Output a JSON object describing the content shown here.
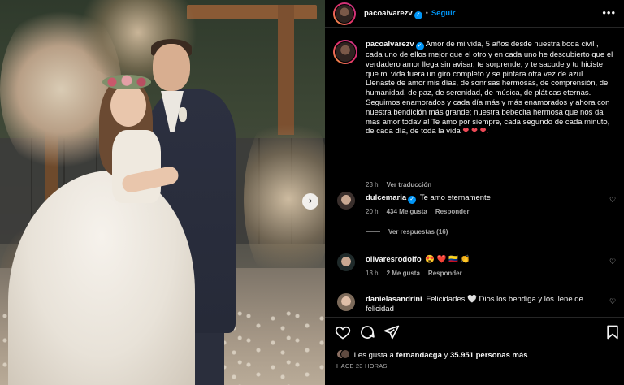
{
  "post": {
    "username": "pacoalvarezv",
    "follow_label": "Seguir",
    "more_label": "•••"
  },
  "caption": {
    "username": "pacoalvarezv",
    "text": "Amor de mi vida, 5 años desde nuestra boda civil , cada uno de ellos mejor que el otro y en cada uno he descubierto que el verdadero amor llega sin avisar, te sorprende, y te sacude y tu hiciste que mi vida fuera un giro completo y se pintara otra vez de azul. Llenaste de amor mis días, de sonrisas hermosas, de comprensión, de humanidad, de paz, de serenidad, de música, de pláticas eternas. Seguimos enamorados y cada día más y más enamorados y ahora con nuestra bendición más grande; nuestra bebecita hermosa que nos da mas amor todavía! Te amo por siempre, cada segundo de cada minuto, de cada día, de toda la vida",
    "hearts": "❤ ❤ ❤.",
    "age": "23 h",
    "translate_label": "Ver traducción"
  },
  "comments": [
    {
      "username": "dulcemaria",
      "verified": true,
      "text": "Te amo eternamente",
      "age": "20 h",
      "likes": "434 Me gusta",
      "reply_label": "Responder",
      "view_replies_label": "Ver respuestas (16)"
    },
    {
      "username": "olivaresrodolfo",
      "verified": false,
      "text": "😍 ❤️ 🇨🇴 👏",
      "age": "13 h",
      "likes": "2 Me gusta",
      "reply_label": "Responder"
    },
    {
      "username": "danielasandrini",
      "verified": false,
      "text": "Felicidades 🤍 Dios los bendiga y los llene de felicidad"
    }
  ],
  "likes": {
    "prefix": "Les gusta a",
    "user": "fernandacga",
    "connector": "y",
    "others": "35.951 personas más"
  },
  "timestamp": "HACE 23 HORAS",
  "icons": {
    "like": "heart-icon",
    "comment": "comment-icon",
    "share": "share-icon",
    "save": "bookmark-icon",
    "next": "chevron-right-icon",
    "more": "more-options-icon"
  },
  "colors": {
    "accent": "#0095f6",
    "background": "#000000",
    "muted": "#a8a8a8",
    "heart": "#ed4956"
  }
}
